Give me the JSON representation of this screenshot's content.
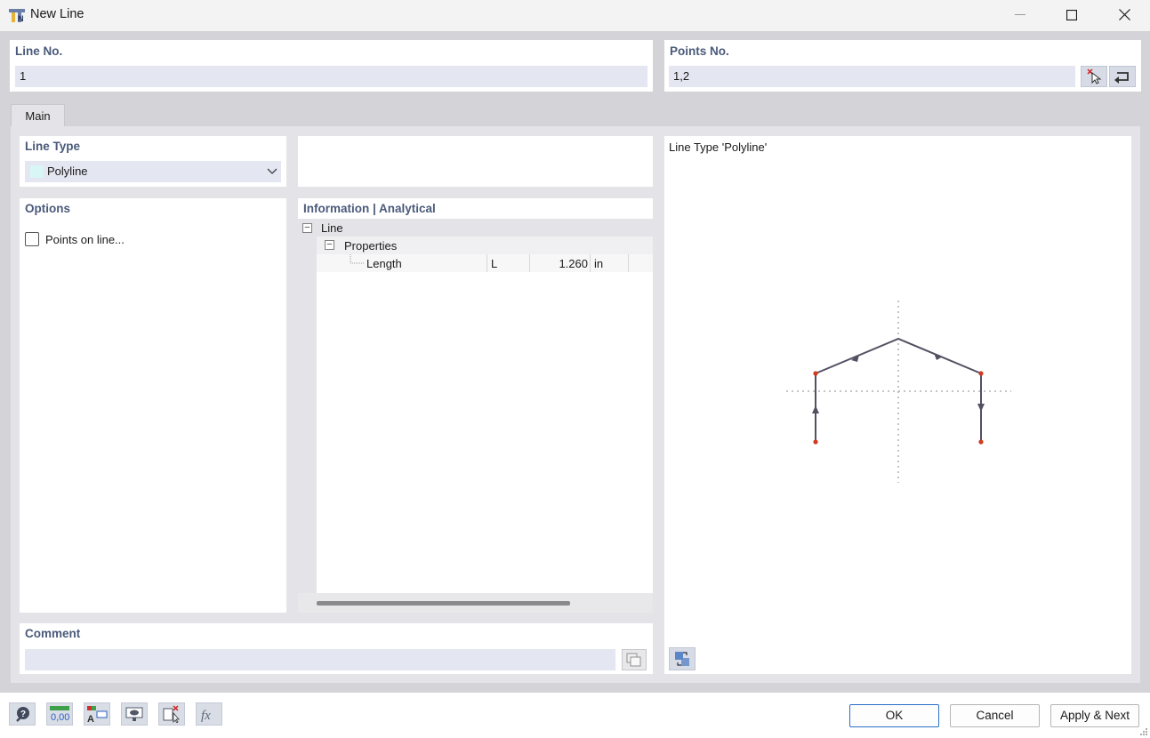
{
  "window": {
    "title": "New Line"
  },
  "line_no": {
    "label": "Line No.",
    "value": "1"
  },
  "points_no": {
    "label": "Points No.",
    "value": "1,2"
  },
  "tabs": [
    {
      "label": "Main"
    }
  ],
  "line_type": {
    "label": "Line Type",
    "selected": "Polyline",
    "swatch_color": "#d8f6f6"
  },
  "options": {
    "label": "Options",
    "points_on_line": "Points on line..."
  },
  "information": {
    "label": "Information | Analytical",
    "tree": {
      "root": "Line",
      "group": "Properties",
      "rows": [
        {
          "name": "Length",
          "symbol": "L",
          "value": "1.260",
          "unit": "in"
        }
      ]
    }
  },
  "preview": {
    "caption": "Line Type 'Polyline'"
  },
  "comment": {
    "label": "Comment",
    "value": ""
  },
  "buttons": {
    "ok": "OK",
    "cancel": "Cancel",
    "apply_next": "Apply & Next"
  },
  "colors": {
    "label": "#4a5a7a",
    "field_bg": "#e4e6f1",
    "polyline": "#545062",
    "point": "#d03a1f"
  },
  "toolbar_icons": [
    "help-icon",
    "units-icon",
    "display-names-icon",
    "view-settings-icon",
    "select-object-icon",
    "formula-icon"
  ]
}
